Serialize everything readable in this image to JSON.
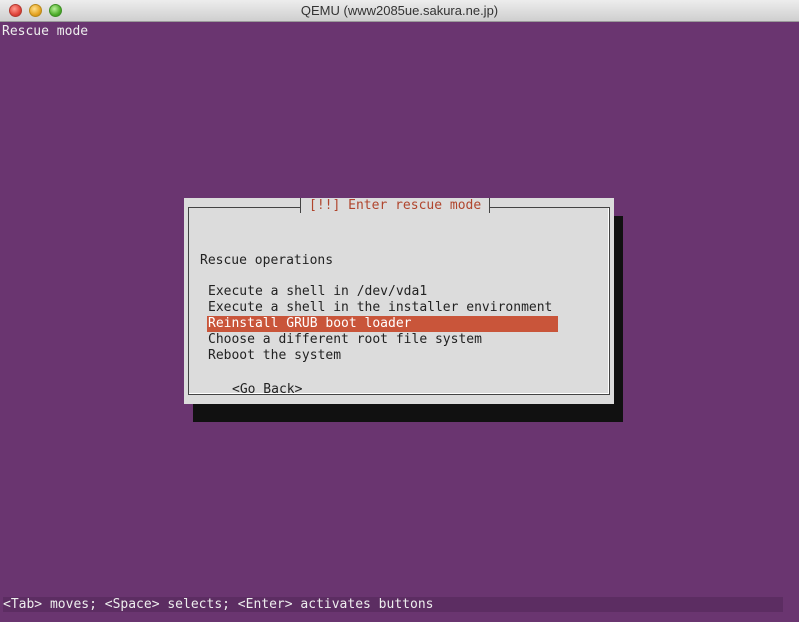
{
  "window": {
    "title": "QEMU (www2085ue.sakura.ne.jp)"
  },
  "screen": {
    "top_label": "Rescue mode",
    "bottom_help": "<Tab> moves; <Space> selects; <Enter> activates buttons"
  },
  "dialog": {
    "title": "[!!] Enter rescue mode",
    "section_label": "Rescue operations",
    "menu_items": [
      {
        "label": "Execute a shell in /dev/vda1",
        "selected": false
      },
      {
        "label": "Execute a shell in the installer environment",
        "selected": false
      },
      {
        "label": "Reinstall GRUB boot loader",
        "selected": true
      },
      {
        "label": "Choose a different root file system",
        "selected": false
      },
      {
        "label": "Reboot the system",
        "selected": false
      }
    ],
    "go_back_label": "<Go Back>"
  },
  "colors": {
    "background": "#6a3570",
    "dialog_bg": "#dcdcdc",
    "selection": "#c9553a",
    "title_text": "#b0452d"
  }
}
